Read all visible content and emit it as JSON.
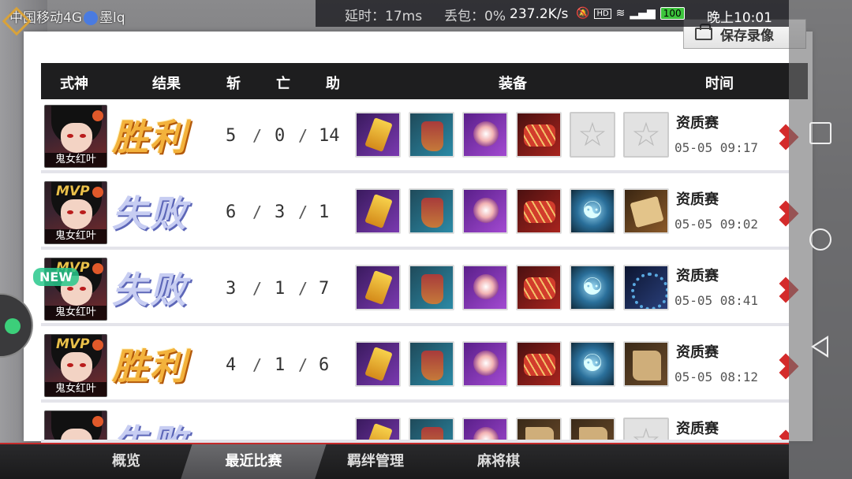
{
  "status_bar": {
    "carrier": "中国移动4G",
    "app_note": "墨lq",
    "latency": "延时：17ms",
    "packet_loss": "丢包：0%",
    "speed": "237.2K/s",
    "battery": "100",
    "time": "晚上10:01"
  },
  "save_button": {
    "label": "保存录像"
  },
  "table": {
    "headers": {
      "shikigami": "式神",
      "result": "结果",
      "kills": "斩",
      "deaths": "亡",
      "assists": "助",
      "equipment": "装备",
      "time": "时间"
    }
  },
  "rows": [
    {
      "hero": "鬼女红叶",
      "mvp": "",
      "result": "胜利",
      "result_type": "win",
      "k": "5",
      "d": "0",
      "a": "14",
      "equip": [
        "scroll",
        "boots",
        "staff",
        "rope",
        "empty",
        "empty"
      ],
      "mode": "资质赛",
      "time": "05-05 09:17"
    },
    {
      "hero": "鬼女红叶",
      "mvp": "MVP",
      "result": "失败",
      "result_type": "lose",
      "k": "6",
      "d": "3",
      "a": "1",
      "equip": [
        "scroll",
        "boots",
        "staff",
        "rope",
        "bagua",
        "map"
      ],
      "mode": "资质赛",
      "time": "05-05 09:02"
    },
    {
      "hero": "鬼女红叶",
      "mvp": "MVP",
      "result": "失败",
      "result_type": "lose",
      "k": "3",
      "d": "1",
      "a": "7",
      "equip": [
        "scroll",
        "boots",
        "staff",
        "rope",
        "bagua",
        "chain"
      ],
      "mode": "资质赛",
      "time": "05-05 08:41"
    },
    {
      "hero": "鬼女红叶",
      "mvp": "MVP",
      "result": "胜利",
      "result_type": "win",
      "k": "4",
      "d": "1",
      "a": "6",
      "equip": [
        "scroll",
        "boots",
        "staff",
        "rope",
        "bagua",
        "parch"
      ],
      "mode": "资质赛",
      "time": "05-05 08:12"
    },
    {
      "hero": "",
      "mvp": "",
      "result": "失败",
      "result_type": "lose",
      "k": "",
      "d": "",
      "a": "",
      "equip": [
        "scroll",
        "boots",
        "staff",
        "parch",
        "parch",
        "empty"
      ],
      "mode": "资质赛",
      "time": ""
    }
  ],
  "separator": "/",
  "tabs": [
    {
      "label": "概览",
      "active": false
    },
    {
      "label": "最近比赛",
      "active": true
    },
    {
      "label": "羁绊管理",
      "active": false
    },
    {
      "label": "麻将棋",
      "active": false
    }
  ],
  "overlay": {
    "new_badge": "NEW"
  },
  "colors": {
    "win": "#f3b23c",
    "lose": "#c7cdf2",
    "accent_red": "#d42b2b",
    "header_bg": "#1e1e1f"
  }
}
